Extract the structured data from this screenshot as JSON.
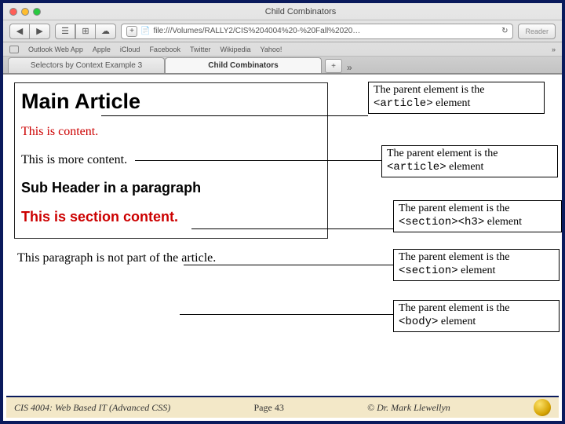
{
  "chrome": {
    "title": "Child Combinators",
    "url": "file:///Volumes/RALLY2/CIS%204004%20-%20Fall%2020…",
    "reader": "Reader",
    "bookmarks": [
      "Outlook Web App",
      "Apple",
      "iCloud",
      "Facebook",
      "Twitter",
      "Wikipedia",
      "Yahoo!"
    ],
    "tabs": {
      "other": "Selectors by Context Example 3",
      "active": "Child Combinators",
      "add": "+",
      "more": "»"
    }
  },
  "content": {
    "h1": "Main Article",
    "p1": "This is content.",
    "p2": "This is more content.",
    "sub": "Sub Header in a paragraph",
    "section_p": "This is section content.",
    "outside": "This paragraph is not part of the article."
  },
  "callouts": {
    "c1a": "The parent element is the",
    "c1b": "<article>",
    "c1c": " element",
    "c2a": "The parent element is the",
    "c2b": "<article>",
    "c2c": " element",
    "c3a": "The parent element is the",
    "c3b": "<section><h3>",
    "c3c": " element",
    "c4a": "The parent element is the",
    "c4b": "<section>",
    "c4c": " element",
    "c5a": "The parent element is the",
    "c5b": "<body>",
    "c5c": " element"
  },
  "footer": {
    "left": "CIS 4004: Web Based IT (Advanced CSS)",
    "mid": "Page 43",
    "right": "© Dr. Mark Llewellyn"
  }
}
